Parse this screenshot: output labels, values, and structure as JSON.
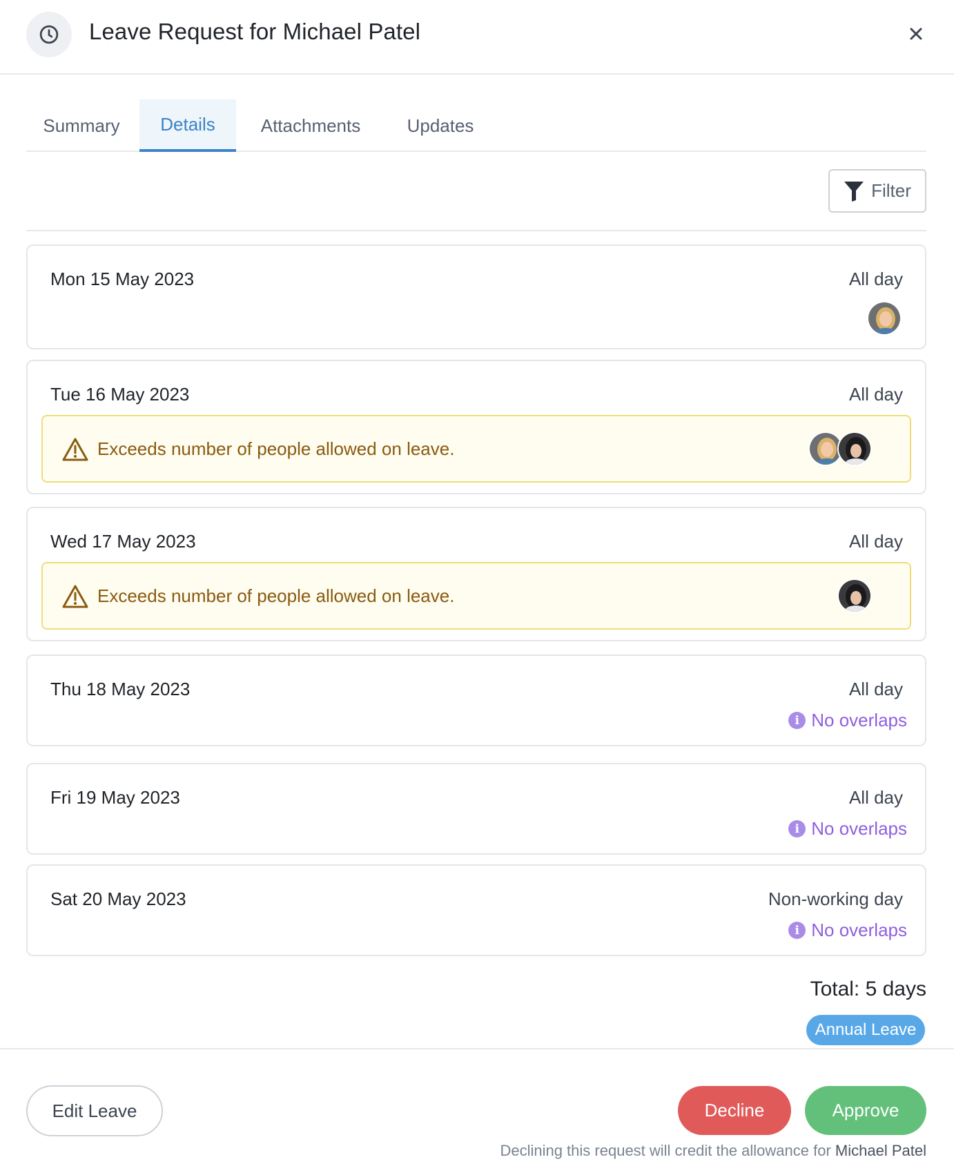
{
  "header": {
    "title": "Leave Request for Michael Patel",
    "icon": "clock-icon",
    "close_icon": "close-icon"
  },
  "tabs": [
    {
      "label": "Summary",
      "active": false
    },
    {
      "label": "Details",
      "active": true
    },
    {
      "label": "Attachments",
      "active": false
    },
    {
      "label": "Updates",
      "active": false
    }
  ],
  "toolbar": {
    "filter_label": "Filter",
    "filter_icon": "funnel-icon"
  },
  "days": [
    {
      "date": "Mon 15 May 2023",
      "type": "All day"
    },
    {
      "date": "Tue 16 May 2023",
      "type": "All day",
      "warning": "Exceeds number of people allowed on leave."
    },
    {
      "date": "Wed 17 May 2023",
      "type": "All day",
      "warning": "Exceeds number of people allowed on leave."
    },
    {
      "date": "Thu 18 May 2023",
      "type": "All day",
      "status": "No overlaps"
    },
    {
      "date": "Fri 19 May 2023",
      "type": "All day",
      "status": "No overlaps"
    },
    {
      "date": "Sat 20 May 2023",
      "type": "Non-working day",
      "status": "No overlaps"
    }
  ],
  "summary": {
    "total": "Total: 5 days",
    "leave_type": "Annual Leave"
  },
  "footer": {
    "edit_label": "Edit Leave",
    "decline_label": "Decline",
    "approve_label": "Approve",
    "note_prefix": "Declining this request will credit the allowance for",
    "note_name": "Michael Patel"
  },
  "colors": {
    "accent": "#3b82c8",
    "warning_bg": "#fefdf0",
    "warning_text": "#8a5a10",
    "info": "#8f5fe0",
    "decline": "#e05a5a",
    "approve": "#62c07a",
    "badge": "#58a8e8"
  }
}
